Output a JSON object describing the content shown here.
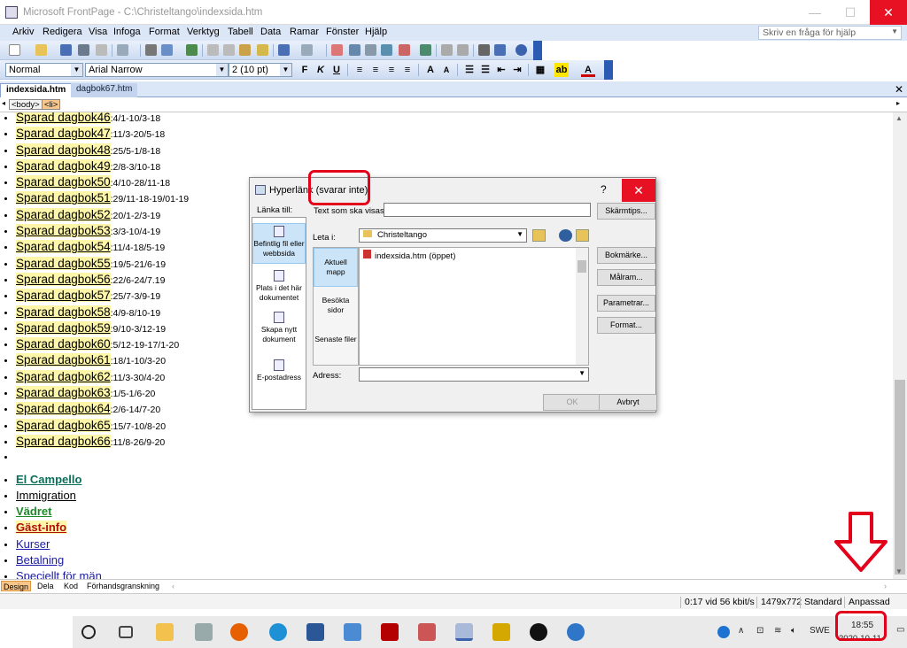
{
  "window": {
    "title": "Microsoft FrontPage - C:\\Christeltango\\indexsida.htm"
  },
  "menu": [
    "Arkiv",
    "Redigera",
    "Visa",
    "Infoga",
    "Format",
    "Verktyg",
    "Tabell",
    "Data",
    "Ramar",
    "Fönster",
    "Hjälp"
  ],
  "help_placeholder": "Skriv en fråga för hjälp",
  "format_toolbar": {
    "style": "Normal",
    "font": "Arial Narrow",
    "size": "2  (10 pt)"
  },
  "tabs": [
    "indexsida.htm",
    "dagbok67.htm"
  ],
  "tags": [
    "<body>",
    "<li>"
  ],
  "diary_entries": [
    {
      "label": "Sparad dagbok46",
      "range": ":4/1-10/3-18"
    },
    {
      "label": "Sparad dagbok47",
      "range": ":11/3-20/5-18"
    },
    {
      "label": "Sparad dagbok48",
      "range": ":25/5-1/8-18"
    },
    {
      "label": "Sparad dagbok49",
      "range": ":2/8-3/10-18"
    },
    {
      "label": "Sparad dagbok50",
      "range": ":4/10-28/11-18"
    },
    {
      "label": "Sparad dagbok51",
      "range": ":29/11-18-19/01-19"
    },
    {
      "label": "Sparad dagbok52",
      "range": ":20/1-2/3-19"
    },
    {
      "label": "Sparad dagbok53",
      "range": ":3/3-10/4-19"
    },
    {
      "label": "Sparad dagbok54",
      "range": ":11/4-18/5-19"
    },
    {
      "label": "Sparad dagbok55",
      "range": ":19/5-21/6-19"
    },
    {
      "label": "Sparad dagbok56",
      "range": ":22/6-24/7.19"
    },
    {
      "label": "Sparad dagbok57",
      "range": ":25/7-3/9-19"
    },
    {
      "label": "Sparad dagbok58",
      "range": ":4/9-8/10-19"
    },
    {
      "label": "Sparad dagbok59",
      "range": ":9/10-3/12-19"
    },
    {
      "label": "Sparad dagbok60",
      "range": ":5/12-19-17/1-20"
    },
    {
      "label": "Sparad dagbok61",
      "range": ":18/1-10/3-20"
    },
    {
      "label": "Sparad dagbok62",
      "range": ":11/3-30/4-20"
    },
    {
      "label": "Sparad dagbok63",
      "range": ":1/5-1/6-20"
    },
    {
      "label": "Sparad dagbok64",
      "range": ":2/6-14/7-20"
    },
    {
      "label": "Sparad dagbok65",
      "range": ":15/7-10/8-20"
    },
    {
      "label": "Sparad dagbok66",
      "range": ":11/8-26/9-20"
    }
  ],
  "nav_links": [
    {
      "label": "El Campello",
      "color": "#0b6f5a",
      "bold": true
    },
    {
      "label": "Immigration",
      "color": "#000000",
      "bold": false
    },
    {
      "label": "Vädret",
      "color": "#1d8a2a",
      "bold": true
    },
    {
      "label": "Gäst-info",
      "color": "#b01010",
      "bold": true
    },
    {
      "label": "Kurser",
      "color": "#1a1aa8",
      "bold": false
    },
    {
      "label": "Betalning",
      "color": "#1a1aa8",
      "bold": false
    },
    {
      "label": "Speciellt för män",
      "color": "#1a1aa8",
      "bold": false
    }
  ],
  "views": [
    "Design",
    "Dela",
    "Kod",
    "Förhandsgranskning"
  ],
  "status": {
    "speed": "0:17 vid 56 kbit/s",
    "size": "1479x772",
    "mode": "Standard",
    "custom": "Anpassad"
  },
  "dialog": {
    "title": "Hyperlänk",
    "not_responding": "(svarar inte)",
    "help": "?",
    "link_to": "Länka till:",
    "text_label": "Text som ska visas:",
    "look_in_label": "Leta i:",
    "look_in_value": "Christeltango",
    "address_label": "Adress:",
    "link_options": [
      "Befintlig fil eller webbsida",
      "Plats i det här dokumentet",
      "Skapa nytt dokument",
      "E-postadress"
    ],
    "places": [
      "Aktuell mapp",
      "Besökta sidor",
      "Senaste filer"
    ],
    "file": "indexsida.htm (öppet)",
    "buttons": {
      "screentip": "Skärmtips...",
      "bookmark": "Bokmärke...",
      "target": "Målram...",
      "params": "Parametrar...",
      "format": "Format...",
      "ok": "OK",
      "cancel": "Avbryt"
    }
  },
  "taskbar": {
    "time": "18:55",
    "date": "2020-10-11",
    "lang": "SWE"
  },
  "colors": {
    "annotation_red": "#e3001b",
    "ribbon_blue": "#dbe6f7",
    "close_red": "#e81123"
  }
}
